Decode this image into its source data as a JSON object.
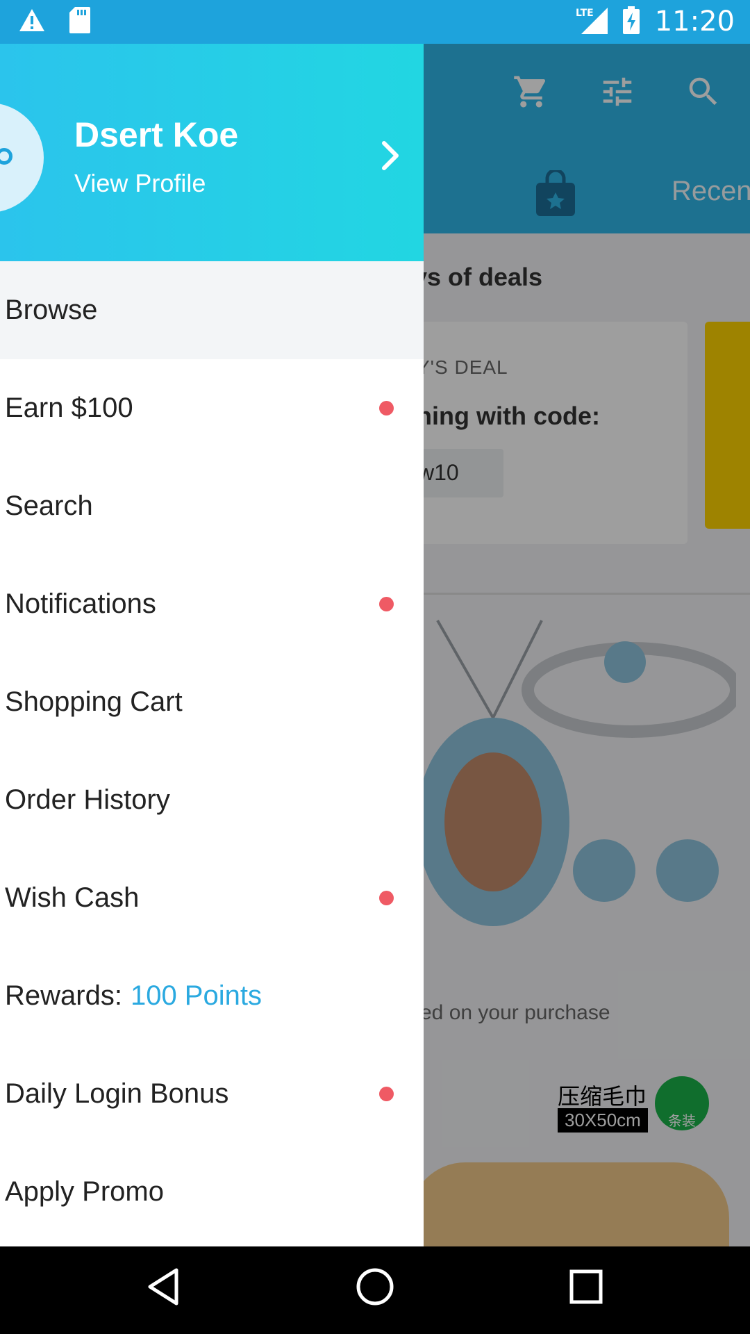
{
  "status_bar": {
    "time": "11:20",
    "network": "LTE",
    "icons": [
      "warning-icon",
      "sd-card-icon",
      "signal-icon",
      "battery-charging-icon"
    ]
  },
  "background": {
    "header_icons": [
      "cart-icon",
      "filter-icon",
      "search-icon"
    ],
    "tab_recent": "Recen",
    "deals_title": "ys of deals",
    "todays_deal": "Y'S DEAL",
    "code_text": "ning with code:",
    "code_value": "w10",
    "earned_text": "ed on your purchase",
    "towel_label": "压缩毛巾",
    "towel_size": "30X50cm",
    "towel_badge": "条装"
  },
  "drawer": {
    "profile": {
      "name": "Dsert Koe",
      "link": "View Profile"
    },
    "menu": [
      {
        "label": "Browse",
        "selected": true,
        "badge": false
      },
      {
        "label": "Earn $100",
        "selected": false,
        "badge": true
      },
      {
        "label": "Search",
        "selected": false,
        "badge": false
      },
      {
        "label": "Notifications",
        "selected": false,
        "badge": true
      },
      {
        "label": "Shopping Cart",
        "selected": false,
        "badge": false
      },
      {
        "label": "Order History",
        "selected": false,
        "badge": false
      },
      {
        "label": "Wish Cash",
        "selected": false,
        "badge": true
      },
      {
        "label": "Rewards:",
        "points": "100 Points",
        "selected": false,
        "badge": false
      },
      {
        "label": "Daily Login Bonus",
        "selected": false,
        "badge": true
      },
      {
        "label": "Apply Promo",
        "selected": false,
        "badge": false
      }
    ]
  },
  "colors": {
    "status_bar": "#1ea3dc",
    "drawer_header": "#22d6e2",
    "badge": "#ef5a64",
    "points": "#2aa9e0"
  },
  "nav_bar": [
    "back-icon",
    "home-icon",
    "recents-icon"
  ]
}
